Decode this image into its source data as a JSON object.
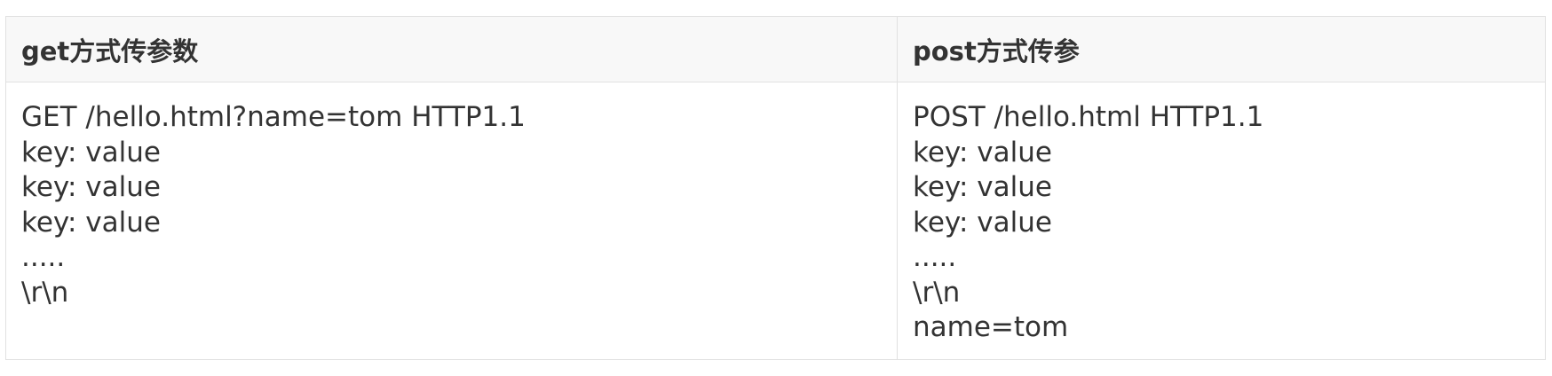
{
  "table": {
    "headers": [
      "get方式传参数",
      "post方式传参"
    ],
    "get_lines": [
      "GET /hello.html?name=tom HTTP1.1",
      "key: value",
      "key: value",
      "key: value",
      ".....",
      "\\r\\n"
    ],
    "post_lines": [
      "POST /hello.html HTTP1.1",
      "key: value",
      "key: value",
      "key: value",
      ".....",
      "\\r\\n",
      "name=tom"
    ]
  }
}
